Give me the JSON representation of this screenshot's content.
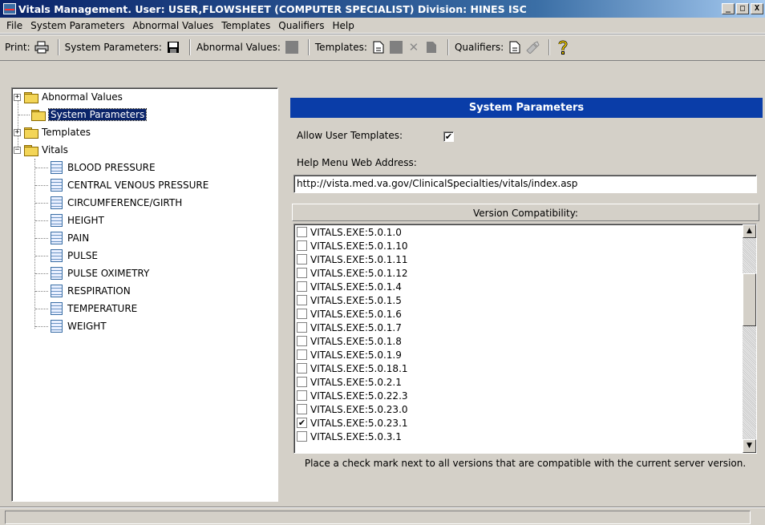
{
  "window": {
    "title": "Vitals Management. User: USER,FLOWSHEET  (COMPUTER SPECIALIST) Division: HINES ISC",
    "min": "_",
    "max": "□",
    "close": "X"
  },
  "menu": [
    "File",
    "System Parameters",
    "Abnormal Values",
    "Templates",
    "Qualifiers",
    "Help"
  ],
  "toolbar": {
    "print": "Print:",
    "system_parameters": "System Parameters:",
    "abnormal_values": "Abnormal Values:",
    "templates": "Templates:",
    "qualifiers": "Qualifiers:"
  },
  "tree": {
    "abnormal_values": "Abnormal Values",
    "system_parameters": "System Parameters",
    "templates": "Templates",
    "vitals": "Vitals",
    "expand": "+",
    "collapse": "−",
    "vital_items": [
      "BLOOD PRESSURE",
      "CENTRAL VENOUS PRESSURE",
      "CIRCUMFERENCE/GIRTH",
      "HEIGHT",
      "PAIN",
      "PULSE",
      "PULSE OXIMETRY",
      "RESPIRATION",
      "TEMPERATURE",
      "WEIGHT"
    ]
  },
  "panel": {
    "title": "System Parameters",
    "allow_user_templates": "Allow User Templates:",
    "allow_checked": "✔",
    "help_label": "Help Menu Web Address:",
    "help_url": "http://vista.med.va.gov/ClinicalSpecialties/vitals/index.asp",
    "version_header": "Version Compatibility:",
    "versions": [
      {
        "label": "VITALS.EXE:5.0.1.0",
        "mark": ""
      },
      {
        "label": "VITALS.EXE:5.0.1.10",
        "mark": ""
      },
      {
        "label": "VITALS.EXE:5.0.1.11",
        "mark": ""
      },
      {
        "label": "VITALS.EXE:5.0.1.12",
        "mark": ""
      },
      {
        "label": "VITALS.EXE:5.0.1.4",
        "mark": ""
      },
      {
        "label": "VITALS.EXE:5.0.1.5",
        "mark": ""
      },
      {
        "label": "VITALS.EXE:5.0.1.6",
        "mark": ""
      },
      {
        "label": "VITALS.EXE:5.0.1.7",
        "mark": ""
      },
      {
        "label": "VITALS.EXE:5.0.1.8",
        "mark": ""
      },
      {
        "label": "VITALS.EXE:5.0.1.9",
        "mark": ""
      },
      {
        "label": "VITALS.EXE:5.0.18.1",
        "mark": ""
      },
      {
        "label": "VITALS.EXE:5.0.2.1",
        "mark": ""
      },
      {
        "label": "VITALS.EXE:5.0.22.3",
        "mark": ""
      },
      {
        "label": "VITALS.EXE:5.0.23.0",
        "mark": ""
      },
      {
        "label": "VITALS.EXE:5.0.23.1",
        "mark": "✔"
      },
      {
        "label": "VITALS.EXE:5.0.3.1",
        "mark": ""
      }
    ],
    "scroll_up": "▲",
    "scroll_down": "▼",
    "help_text": "Place a check mark next to all versions that are compatible with the current server version."
  }
}
